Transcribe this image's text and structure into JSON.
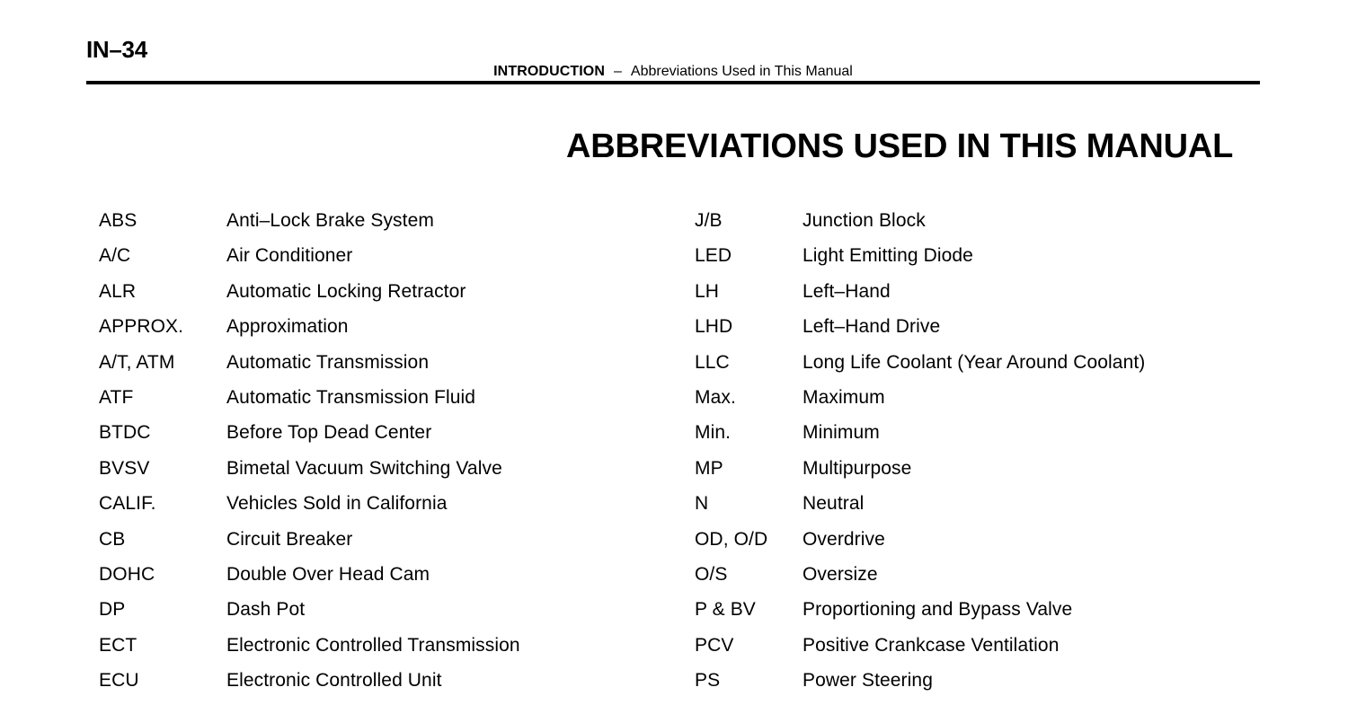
{
  "page": {
    "number": "IN–34"
  },
  "running_head": {
    "section": "INTRODUCTION",
    "separator": "–",
    "topic": "Abbreviations Used in This Manual"
  },
  "title": "ABBREVIATIONS USED IN THIS MANUAL",
  "columns": {
    "left": [
      {
        "abbr": "ABS",
        "meaning": "Anti–Lock Brake System"
      },
      {
        "abbr": "A/C",
        "meaning": "Air Conditioner"
      },
      {
        "abbr": "ALR",
        "meaning": "Automatic Locking Retractor"
      },
      {
        "abbr": "APPROX.",
        "meaning": "Approximation"
      },
      {
        "abbr": "A/T, ATM",
        "meaning": "Automatic Transmission"
      },
      {
        "abbr": "ATF",
        "meaning": "Automatic Transmission Fluid"
      },
      {
        "abbr": "BTDC",
        "meaning": "Before Top Dead Center"
      },
      {
        "abbr": "BVSV",
        "meaning": "Bimetal Vacuum Switching Valve"
      },
      {
        "abbr": "CALIF.",
        "meaning": "Vehicles Sold in California"
      },
      {
        "abbr": "CB",
        "meaning": "Circuit Breaker"
      },
      {
        "abbr": "DOHC",
        "meaning": "Double Over Head Cam"
      },
      {
        "abbr": "DP",
        "meaning": "Dash Pot"
      },
      {
        "abbr": "ECT",
        "meaning": "Electronic Controlled Transmission"
      },
      {
        "abbr": "ECU",
        "meaning": "Electronic Controlled Unit"
      }
    ],
    "right": [
      {
        "abbr": "J/B",
        "meaning": "Junction Block"
      },
      {
        "abbr": "LED",
        "meaning": "Light Emitting Diode"
      },
      {
        "abbr": "LH",
        "meaning": "Left–Hand"
      },
      {
        "abbr": "LHD",
        "meaning": "Left–Hand Drive"
      },
      {
        "abbr": "LLC",
        "meaning": "Long Life Coolant (Year Around Coolant)"
      },
      {
        "abbr": "Max.",
        "meaning": "Maximum"
      },
      {
        "abbr": "Min.",
        "meaning": "Minimum"
      },
      {
        "abbr": "MP",
        "meaning": "Multipurpose"
      },
      {
        "abbr": "N",
        "meaning": "Neutral"
      },
      {
        "abbr": "OD, O/D",
        "meaning": "Overdrive"
      },
      {
        "abbr": "O/S",
        "meaning": "Oversize"
      },
      {
        "abbr": "P & BV",
        "meaning": "Proportioning and Bypass Valve"
      },
      {
        "abbr": "PCV",
        "meaning": "Positive Crankcase Ventilation"
      },
      {
        "abbr": "PS",
        "meaning": "Power Steering"
      }
    ]
  }
}
